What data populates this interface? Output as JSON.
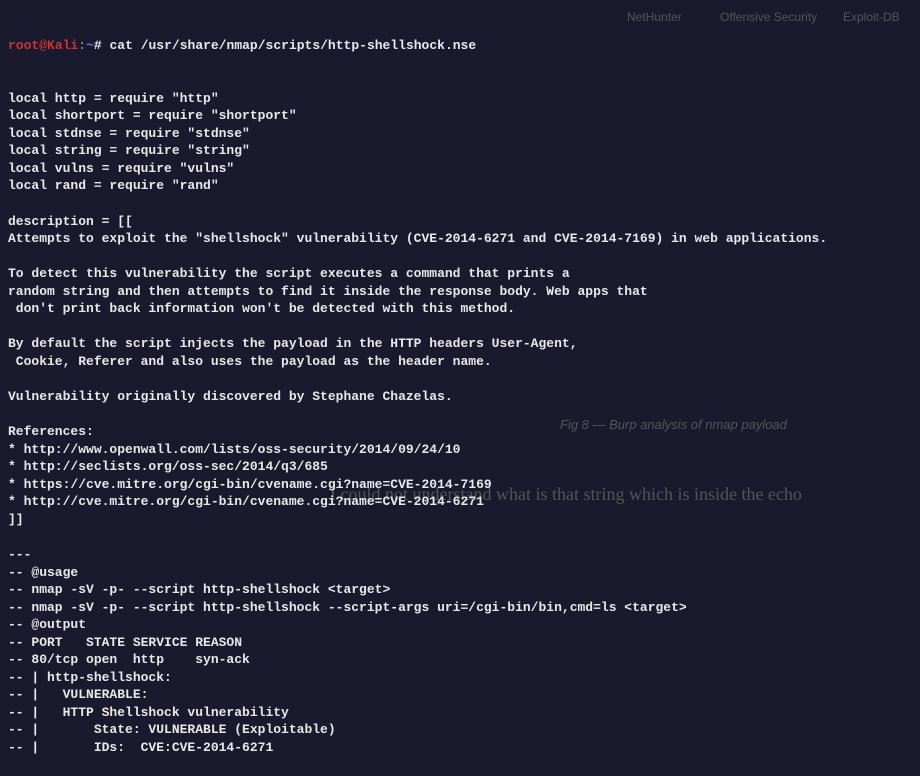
{
  "terminal": {
    "prompt": {
      "user": "root",
      "at": "@",
      "host": "Kali",
      "sep": ":",
      "path": "~",
      "hash": "#"
    },
    "command": "cat /usr/share/nmap/scripts/http-shellshock.nse",
    "lines": [
      "local http = require \"http\"",
      "local shortport = require \"shortport\"",
      "local stdnse = require \"stdnse\"",
      "local string = require \"string\"",
      "local vulns = require \"vulns\"",
      "local rand = require \"rand\"",
      "",
      "description = [[",
      "Attempts to exploit the \"shellshock\" vulnerability (CVE-2014-6271 and CVE-2014-7169) in web applications.",
      "",
      "To detect this vulnerability the script executes a command that prints a",
      "random string and then attempts to find it inside the response body. Web apps that",
      " don't print back information won't be detected with this method.",
      "",
      "By default the script injects the payload in the HTTP headers User-Agent,",
      " Cookie, Referer and also uses the payload as the header name.",
      "",
      "Vulnerability originally discovered by Stephane Chazelas.",
      "",
      "References:",
      "* http://www.openwall.com/lists/oss-security/2014/09/24/10",
      "* http://seclists.org/oss-sec/2014/q3/685",
      "* https://cve.mitre.org/cgi-bin/cvename.cgi?name=CVE-2014-7169",
      "* http://cve.mitre.org/cgi-bin/cvename.cgi?name=CVE-2014-6271",
      "]]",
      "",
      "---",
      "-- @usage",
      "-- nmap -sV -p- --script http-shellshock <target>",
      "-- nmap -sV -p- --script http-shellshock --script-args uri=/cgi-bin/bin,cmd=ls <target>",
      "-- @output",
      "-- PORT   STATE SERVICE REASON",
      "-- 80/tcp open  http    syn-ack",
      "-- | http-shellshock:",
      "-- |   VULNERABLE:",
      "-- |   HTTP Shellshock vulnerability",
      "-- |       State: VULNERABLE (Exploitable)",
      "-- |       IDs:  CVE:CVE-2014-6271"
    ]
  },
  "background": {
    "nav1": "NetHunter",
    "nav2": "Offensive Security",
    "nav3": "Exploit-DB",
    "fig": "Fig 8 — Burp analysis of nmap payload",
    "text1": "I could not understand what is that string which is inside the echo"
  }
}
